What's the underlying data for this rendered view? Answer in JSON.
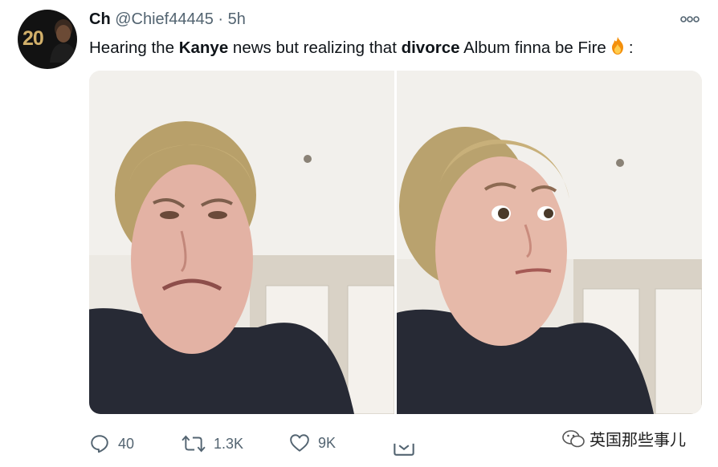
{
  "tweet": {
    "avatar_number": "20",
    "display_name": "Ch",
    "handle": "@Chief44445",
    "separator": "·",
    "time": "5h",
    "text_parts": [
      "Hearing the ",
      "Kanye",
      " news but realizing that ",
      "divorce",
      " Album finna be Fire",
      ":"
    ],
    "fire_emoji_icon": "fire-emoji",
    "media_icons": [
      "disgusted-face-photo",
      "looking-away-photo"
    ]
  },
  "actions": {
    "reply_count": "40",
    "retweet_count": "1.3K",
    "like_count": "9K"
  },
  "watermark": {
    "text": "英国那些事儿"
  },
  "colors": {
    "text_primary": "#0f1419",
    "text_secondary": "#536471"
  }
}
